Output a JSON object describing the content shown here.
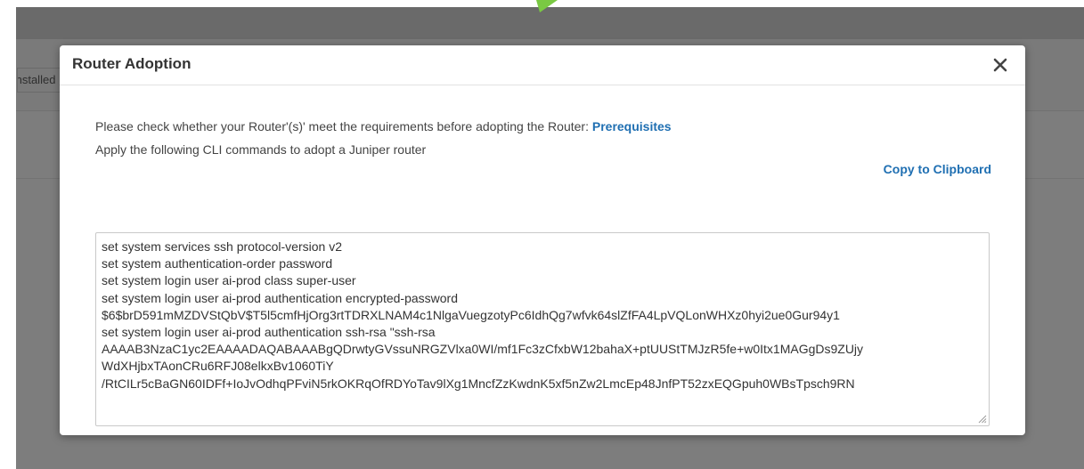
{
  "background": {
    "tab_label": "Installed"
  },
  "modal": {
    "title": "Router Adoption",
    "close_label": "×",
    "requirements_text": "Please check whether your Router'(s)' meet the requirements before adopting the Router: ",
    "prerequisites_link": "Prerequisites",
    "apply_text": "Apply the following CLI commands to adopt a Juniper router",
    "copy_label": "Copy to Clipboard",
    "cli_lines": [
      "set system services ssh protocol-version v2",
      "set system authentication-order password",
      "set system login user ai-prod class super-user",
      "set system login user ai-prod authentication encrypted-password",
      "$6$brD591mMZDVStQbV$T5l5cmfHjOrg3rtTDRXLNAM4c1NlgaVuegzotyPc6IdhQg7wfvk64slZfFA4LpVQLonWHXz0hyi2ue0Gur94y1",
      "set system login user ai-prod authentication ssh-rsa \"ssh-rsa",
      "AAAAB3NzaC1yc2EAAAADAQABAAABgQDrwtyGVssuNRGZVlxa0WI/mf1Fc3zCfxbW12bahaX+ptUUStTMJzR5fe+w0Itx1MAGgDs9ZUjy",
      "WdXHjbxTAonCRu6RFJ08elkxBv1060TiY",
      "/RtCILr5cBaGN60IDFf+IoJvOdhqPFviN5rkOKRqOfRDYoTav9lXg1MncfZzKwdnK5xf5nZw2LmcEp48JnfPT52zxEQGpuh0WBsTpsch9RN"
    ]
  },
  "colors": {
    "link": "#1f6fb2",
    "overlay": "#7d7d7d",
    "accent": "#7ac943"
  }
}
